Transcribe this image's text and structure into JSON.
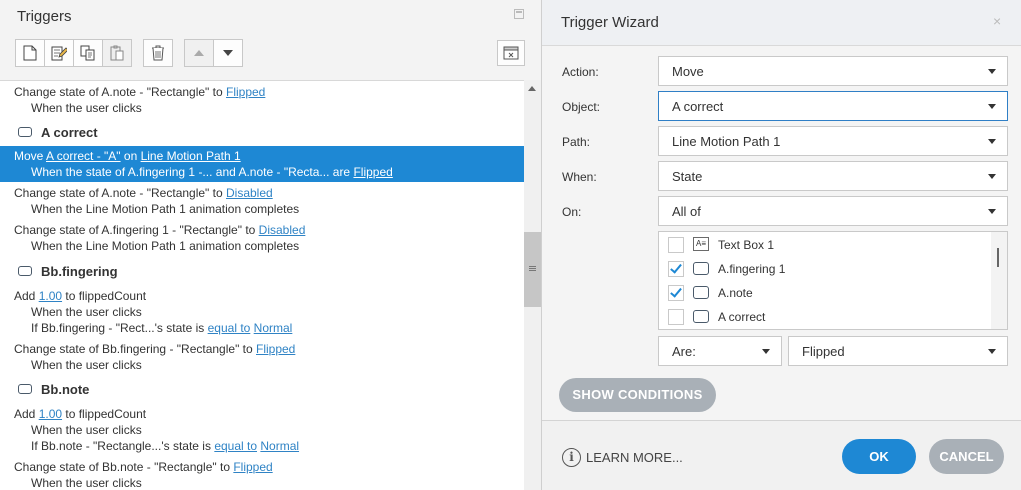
{
  "triggers_panel": {
    "title": "Triggers"
  },
  "trigger_list": {
    "r1": {
      "prefix": "Change state of A.note - \"Rectangle\" to ",
      "link": "Flipped",
      "sub": "When the user clicks"
    },
    "group_a_correct": "A correct",
    "r2": {
      "prefix": "Move ",
      "link1": "A correct - \"A\"",
      "mid": " on ",
      "link2": "Line Motion Path 1",
      "sub_prefix": "When the state of A.fingering 1 -... and A.note - \"Recta... are ",
      "sub_link": "Flipped"
    },
    "r3": {
      "prefix": "Change state of A.note - \"Rectangle\" to ",
      "link": "Disabled",
      "sub": "When the Line Motion Path 1 animation completes"
    },
    "r4": {
      "prefix": "Change state of A.fingering 1 - \"Rectangle\" to ",
      "link": "Disabled",
      "sub": "When the Line Motion Path 1 animation completes"
    },
    "group_bb_fingering": "Bb.fingering",
    "r5": {
      "prefix": "Add ",
      "link": "1.00",
      "suffix": " to flippedCount",
      "sub": "When the user clicks",
      "cond_prefix": "If Bb.fingering - \"Rect...'s state is ",
      "cond_link1": "equal to",
      "cond_mid": " ",
      "cond_link2": "Normal"
    },
    "r6": {
      "prefix": "Change state of Bb.fingering - \"Rectangle\" to ",
      "link": "Flipped",
      "sub": "When the user clicks"
    },
    "group_bb_note": "Bb.note",
    "r7": {
      "prefix": "Add ",
      "link": "1.00",
      "suffix": " to flippedCount",
      "sub": "When the user clicks",
      "cond_prefix": "If Bb.note - \"Rectangle...'s state is ",
      "cond_link1": "equal to",
      "cond_mid": " ",
      "cond_link2": "Normal"
    },
    "r8": {
      "prefix": "Change state of Bb.note - \"Rectangle\" to ",
      "link": "Flipped",
      "sub": "When the user clicks"
    }
  },
  "wizard": {
    "title": "Trigger Wizard",
    "close_glyph": "×",
    "action_label": "Action:",
    "action_value": "Move",
    "object_label": "Object:",
    "object_value": "A correct",
    "path_label": "Path:",
    "path_value": "Line Motion Path 1",
    "when_label": "When:",
    "when_value": "State",
    "on_label": "On:",
    "on_value": "All of",
    "objects": [
      {
        "label": "Text Box 1",
        "checked": false,
        "icon": "text-box-icon"
      },
      {
        "label": "A.fingering 1",
        "checked": true,
        "icon": "rectangle-icon"
      },
      {
        "label": "A.note",
        "checked": true,
        "icon": "rectangle-icon"
      },
      {
        "label": "A correct",
        "checked": false,
        "icon": "rectangle-icon"
      }
    ],
    "are_value": "Are:",
    "state_value": "Flipped",
    "show_conditions_label": "SHOW CONDITIONS",
    "learn_more_label": "LEARN MORE...",
    "ok_label": "OK",
    "cancel_label": "CANCEL"
  },
  "colors": {
    "accent": "#1e88d4",
    "link": "#2f83c5",
    "secondary_button": "#a9b0b7"
  }
}
